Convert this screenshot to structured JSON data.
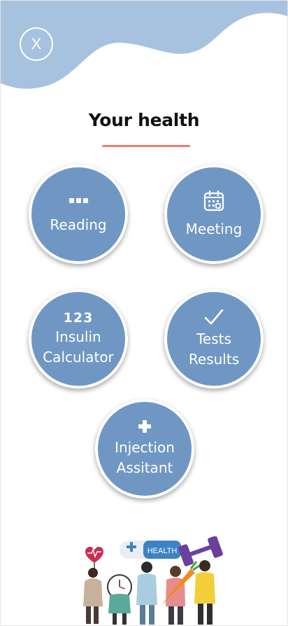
{
  "header": {
    "close_label": "X",
    "title": "Your health"
  },
  "tiles": [
    {
      "icon": "dots-icon",
      "label": "Reading"
    },
    {
      "icon": "calendar-icon",
      "label": "Meeting"
    },
    {
      "icon": "numbers-icon",
      "icon_text": "123",
      "label_line1": "Insulin",
      "label_line2": "Calculator"
    },
    {
      "icon": "checkmark-icon",
      "label_line1": "Tests",
      "label_line2": "Results"
    },
    {
      "icon": "plus-icon",
      "label_line1": "Injection",
      "label_line2": "Assitant"
    }
  ],
  "illustration": {
    "sign_text": "HEALTH"
  },
  "colors": {
    "accent_blue": "#7097c4",
    "wave_blue": "#a7c2df",
    "underline_coral": "#ef7f6c"
  }
}
